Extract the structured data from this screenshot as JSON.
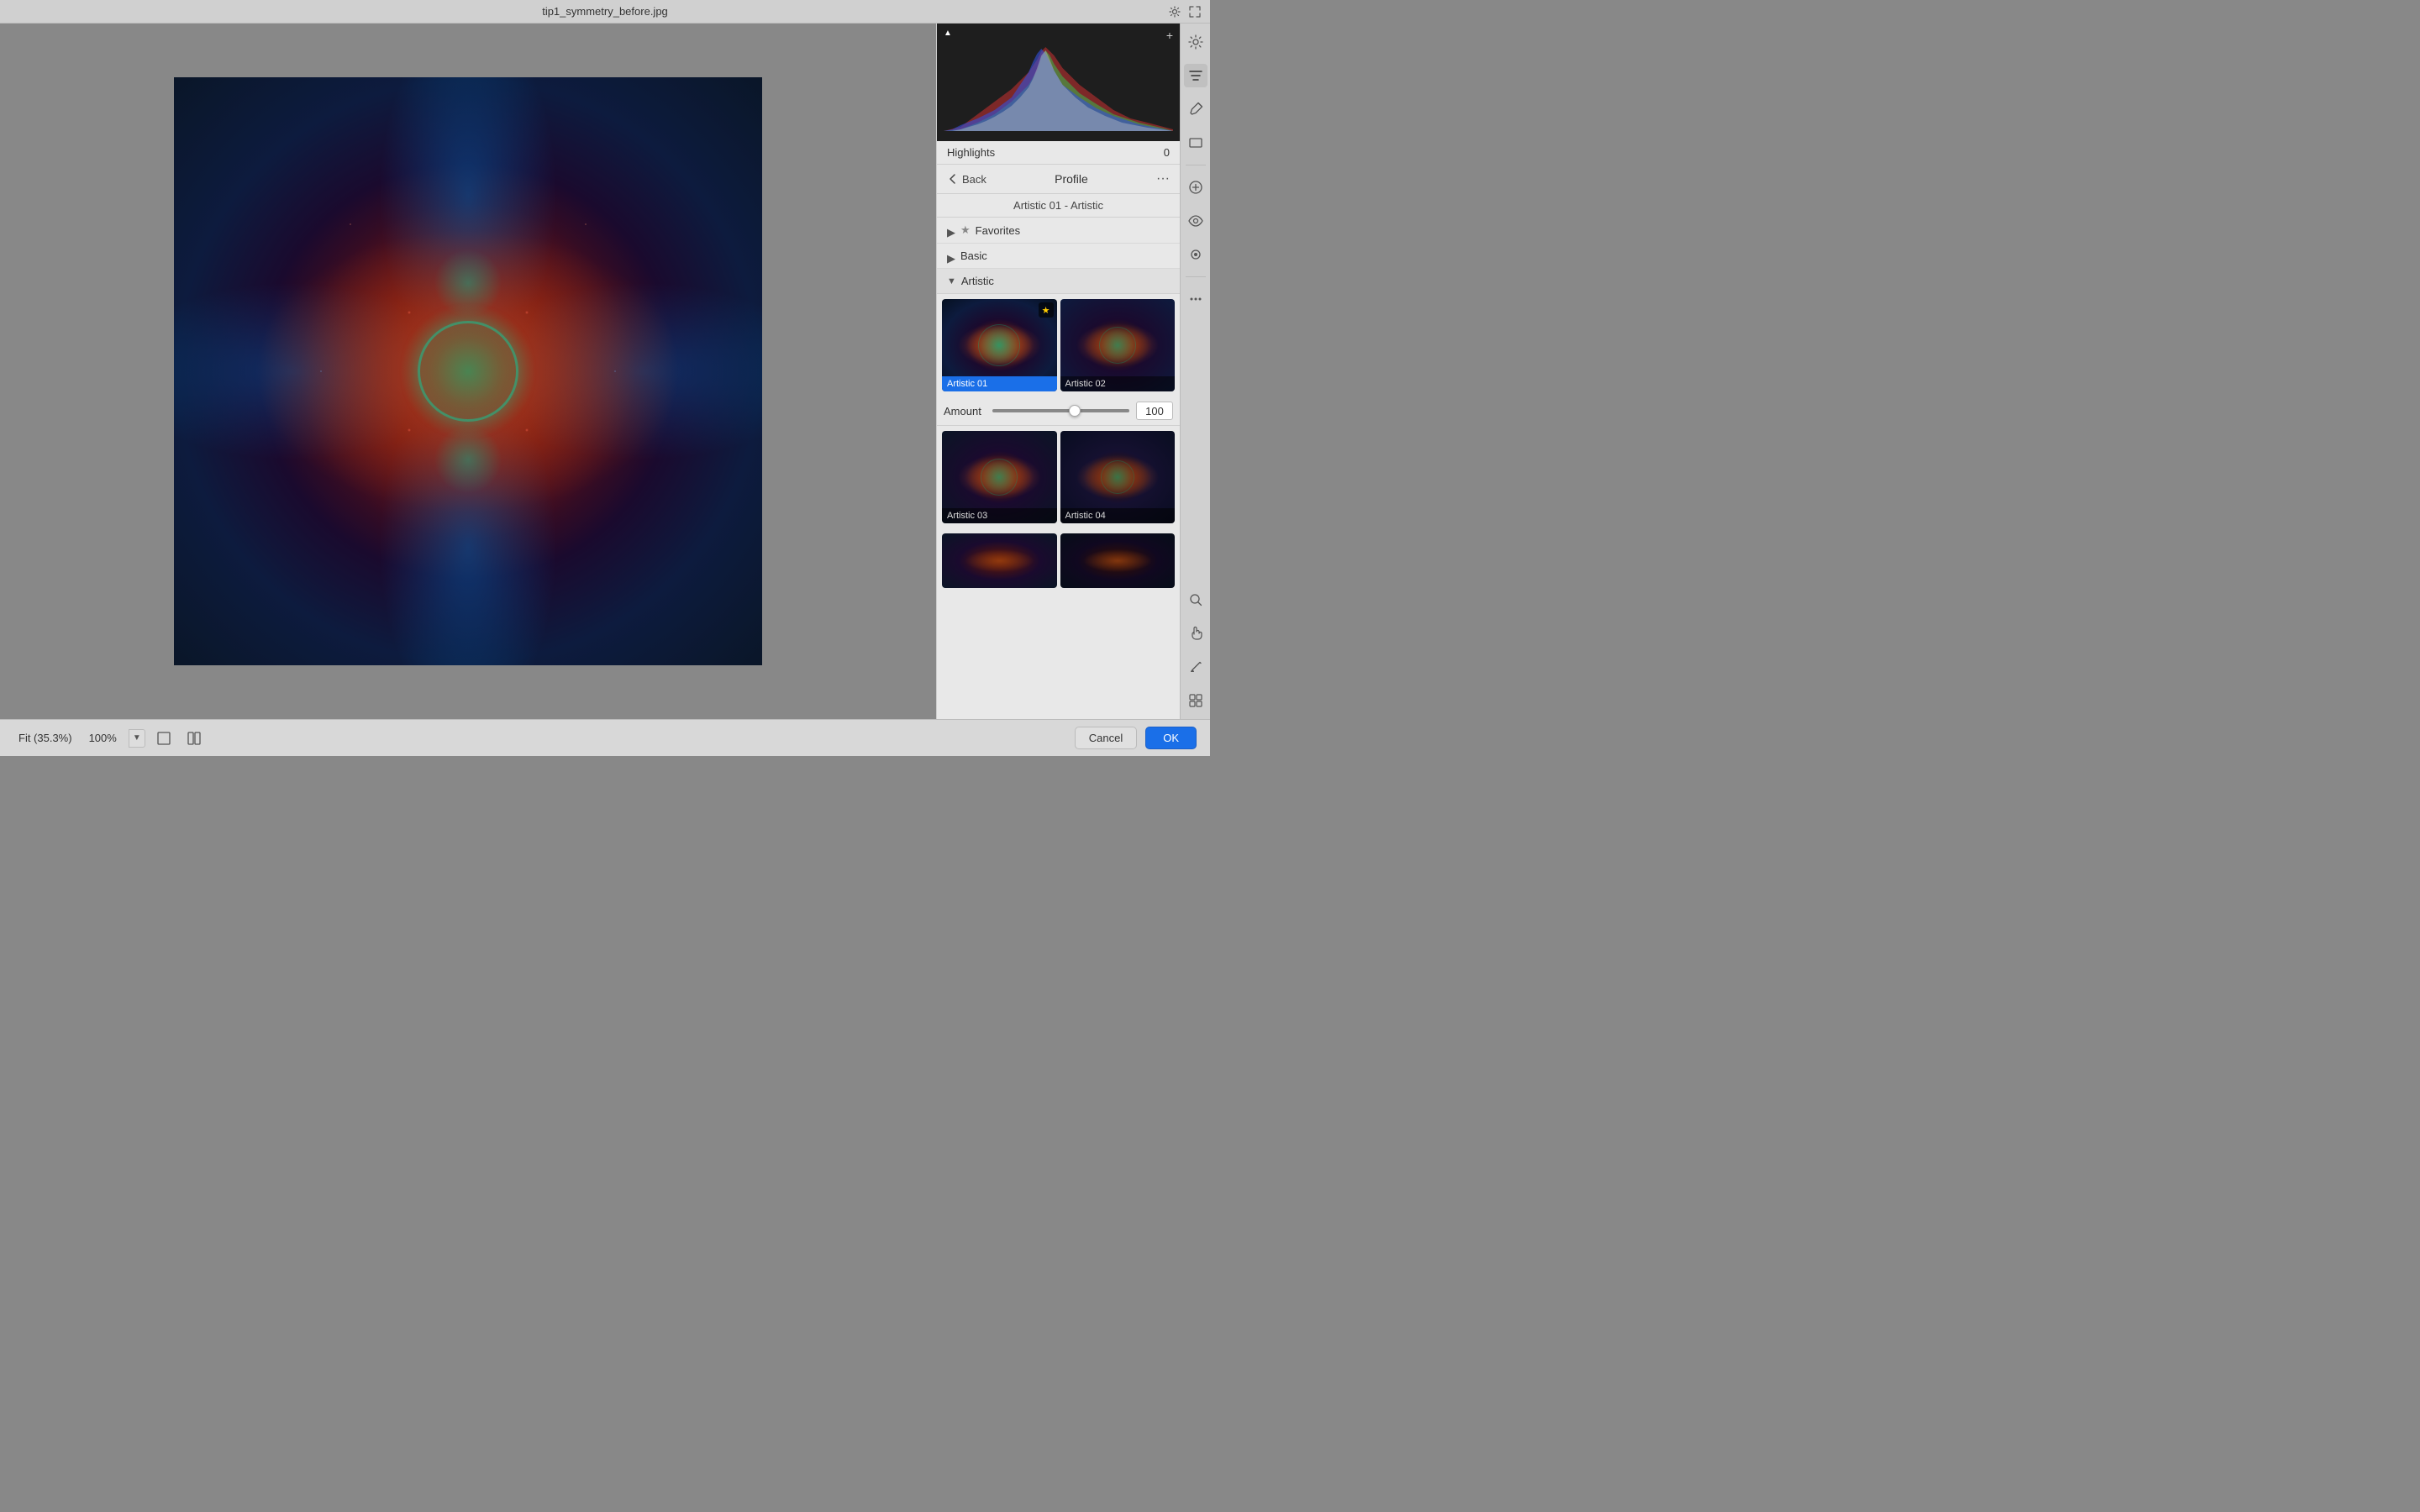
{
  "titleBar": {
    "title": "tip1_symmetry_before.jpg",
    "settingsIcon": "⚙",
    "expandIcon": "⤢"
  },
  "histogram": {
    "expandIcon": "+",
    "cornerIcon": "▲"
  },
  "highlights": {
    "label": "Highlights",
    "value": "0"
  },
  "profileHeader": {
    "backLabel": "Back",
    "title": "Profile",
    "moreIcon": "···"
  },
  "profileSubtitle": "Artistic 01 - Artistic",
  "sections": {
    "favorites": {
      "label": "Favorites",
      "starIcon": "★",
      "toggleIcon": "▶"
    },
    "basic": {
      "label": "Basic",
      "toggleIcon": "▶"
    },
    "artistic": {
      "label": "Artistic",
      "toggleIcon": "▼"
    }
  },
  "presets": {
    "artistic01": {
      "label": "Artistic 01",
      "selected": true,
      "hasStar": true
    },
    "artistic02": {
      "label": "Artistic 02",
      "selected": false,
      "hasStar": false
    },
    "artistic03": {
      "label": "Artistic 03",
      "selected": false,
      "hasStar": false
    },
    "artistic04": {
      "label": "Artistic 04",
      "selected": false,
      "hasStar": false
    }
  },
  "amount": {
    "label": "Amount",
    "value": "100"
  },
  "bottomBar": {
    "fitLabel": "Fit (35.3%)",
    "zoomLabel": "100%",
    "dropdownIcon": "▼",
    "cancelLabel": "Cancel",
    "okLabel": "OK"
  },
  "tools": {
    "adjustIcon": "⚙",
    "filterIcon": "≡",
    "pencilIcon": "✏",
    "rectIcon": "▭",
    "circleIcon": "◎",
    "plusIcon": "+",
    "eyeIcon": "👁",
    "paintIcon": "●",
    "dotsIcon": "···",
    "searchIcon": "🔍",
    "handIcon": "✋",
    "brushIcon": "✏",
    "gridIcon": "⊞"
  }
}
